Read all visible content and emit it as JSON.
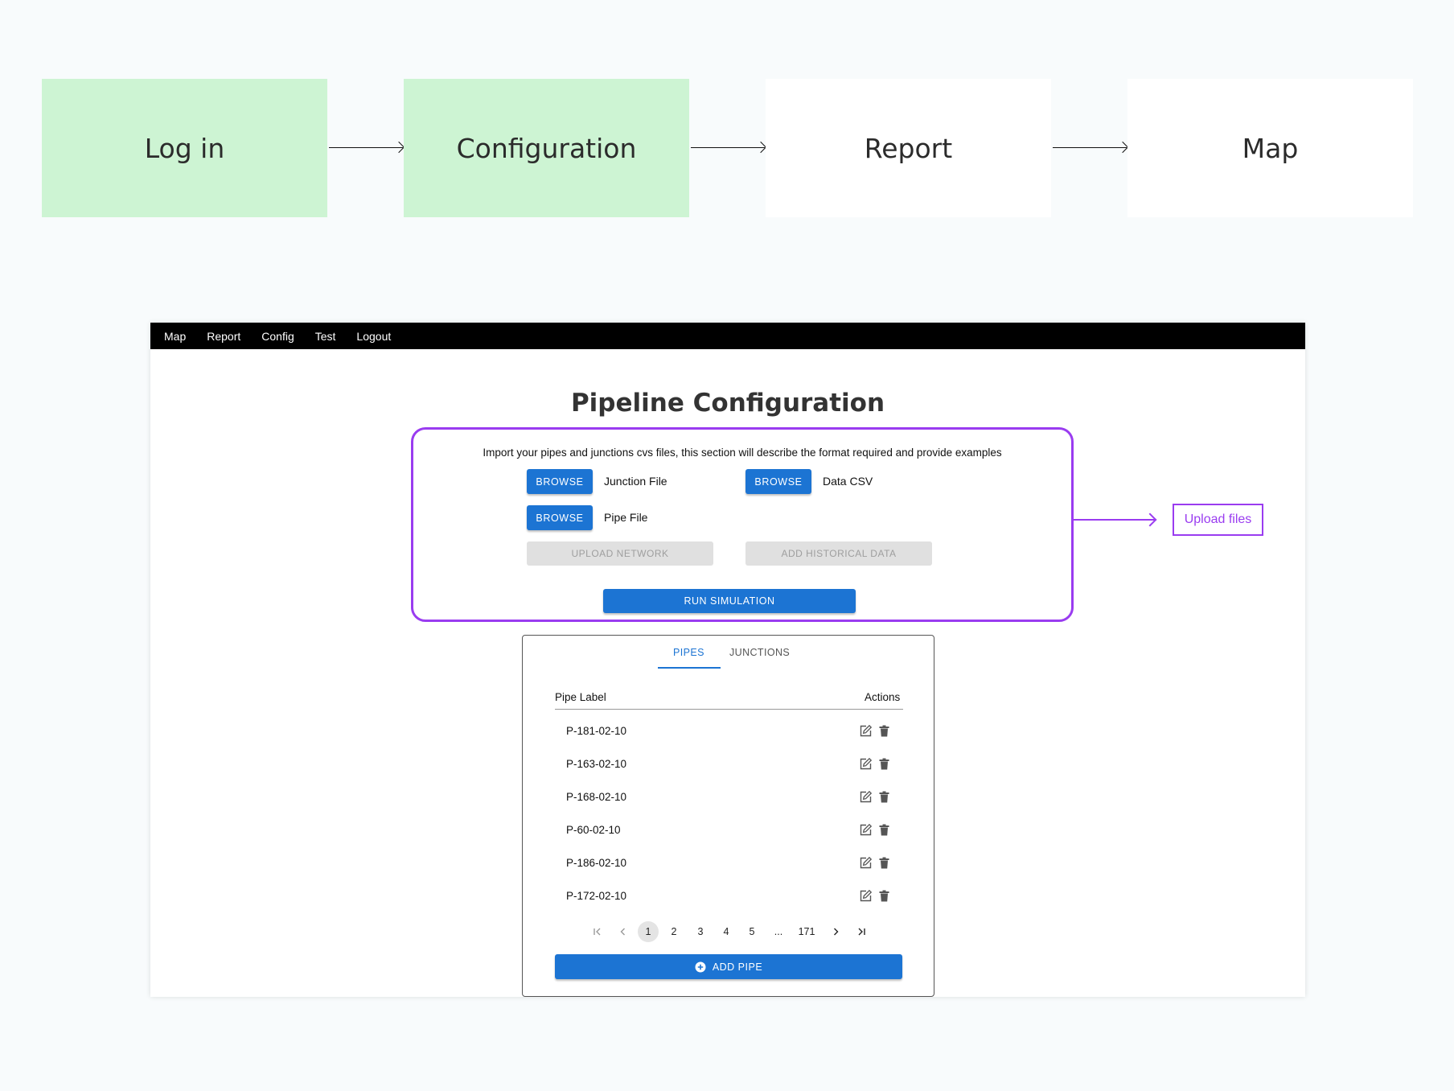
{
  "flow": {
    "steps": [
      {
        "label": "Log in",
        "state": "done"
      },
      {
        "label": "Configuration",
        "state": "done"
      },
      {
        "label": "Report",
        "state": "todo"
      },
      {
        "label": "Map",
        "state": "todo"
      }
    ]
  },
  "nav": {
    "items": [
      "Map",
      "Report",
      "Config",
      "Test",
      "Logout"
    ]
  },
  "page": {
    "title": "Pipeline Configuration"
  },
  "config": {
    "description": "Import your pipes and junctions cvs files, this section will describe the format required and provide examples",
    "browse_label": "BROWSE",
    "junction_file_label": "Junction File",
    "data_csv_label": "Data CSV",
    "pipe_file_label": "Pipe File",
    "upload_network_label": "UPLOAD NETWORK",
    "add_historical_label": "ADD HISTORICAL DATA",
    "run_simulation_label": "RUN SIMULATION"
  },
  "annotation": {
    "upload_files_label": "Upload files",
    "accent_color": "#9a3cf0"
  },
  "table": {
    "tabs": [
      "PIPES",
      "JUNCTIONS"
    ],
    "active_tab": "PIPES",
    "columns": [
      "Pipe Label",
      "Actions"
    ],
    "rows": [
      "P-181-02-10",
      "P-163-02-10",
      "P-168-02-10",
      "P-60-02-10",
      "P-186-02-10",
      "P-172-02-10"
    ],
    "pagination": {
      "pages": [
        "1",
        "2",
        "3",
        "4",
        "5",
        "...",
        "171"
      ],
      "current": "1"
    },
    "add_label": "ADD PIPE"
  },
  "colors": {
    "primary": "#1c74d3",
    "done_step": "#cdf4d3"
  }
}
